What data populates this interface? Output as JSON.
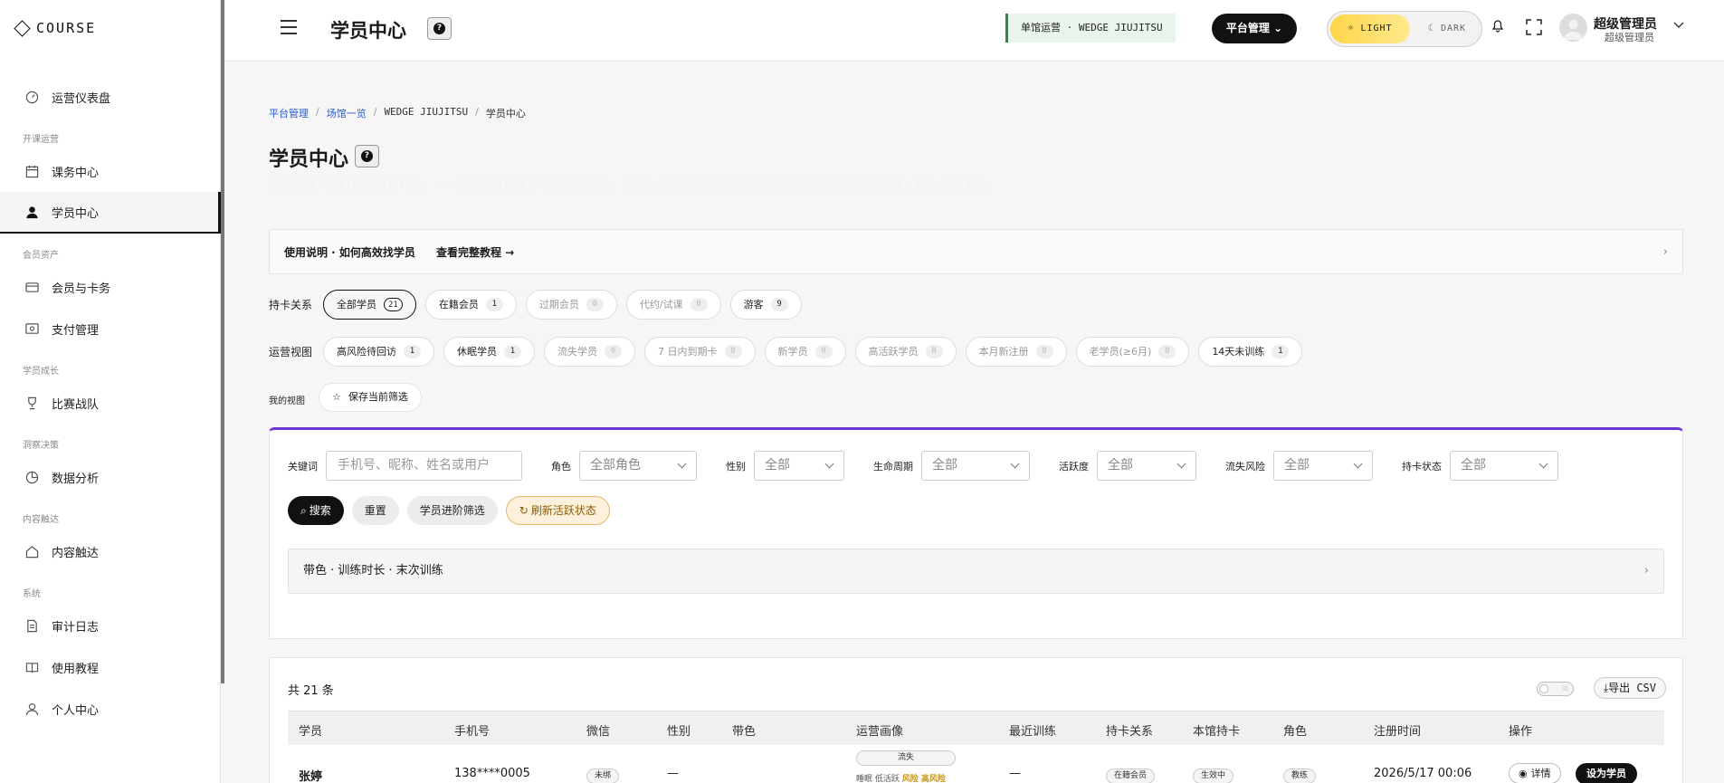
{
  "brand": {
    "name": "COURSE"
  },
  "sidebar": {
    "items": [
      {
        "label": "运营仪表盘",
        "icon": "gauge-icon"
      },
      {
        "group": "开课运营"
      },
      {
        "label": "课务中心",
        "icon": "calendar-icon"
      },
      {
        "label": "学员中心",
        "icon": "user-icon",
        "active": true
      },
      {
        "group": "会员资产"
      },
      {
        "label": "会员与卡务",
        "icon": "card-icon"
      },
      {
        "label": "支付管理",
        "icon": "payment-icon"
      },
      {
        "group": "学员成长"
      },
      {
        "label": "比赛战队",
        "icon": "trophy-icon"
      },
      {
        "group": "洞察决策"
      },
      {
        "label": "数据分析",
        "icon": "chart-icon"
      },
      {
        "group": "内容触达"
      },
      {
        "label": "内容触达",
        "icon": "home-icon"
      },
      {
        "group": "系统"
      },
      {
        "label": "审计日志",
        "icon": "document-icon"
      },
      {
        "label": "使用教程",
        "icon": "book-icon"
      },
      {
        "label": "个人中心",
        "icon": "person-icon"
      }
    ]
  },
  "topbar": {
    "title": "学员中心",
    "venue": "单馆运营 · WEDGE JIUJITSU",
    "platform_btn": "平台管理",
    "theme_light": "LIGHT",
    "theme_dark": "DARK",
    "user_name": "超级管理员",
    "user_role": "超级管理员"
  },
  "breadcrumb": {
    "items": [
      "平台管理",
      "场馆一览",
      "WEDGE JIUJITSU",
      "学员中心"
    ]
  },
  "page": {
    "title": "学员中心",
    "description": "当前场馆「WEDGE JIUJITSU」——列表与详情操作均限定在该馆。列表中的彩色标签为系统根据签到自动计算的运营画像，纳入工作关注。"
  },
  "guide": {
    "title": "使用说明 · 如何高效找学员",
    "link": "查看完整教程 →"
  },
  "card_relation": {
    "label": "持卡关系",
    "chips": [
      {
        "label": "全部学员",
        "count": "21",
        "selected": true
      },
      {
        "label": "在籍会员",
        "count": "1"
      },
      {
        "label": "过期会员",
        "count": "0",
        "muted": true
      },
      {
        "label": "代约/试课",
        "count": "0",
        "muted": true
      },
      {
        "label": "游客",
        "count": "9"
      }
    ]
  },
  "ops_view": {
    "label": "运营视图",
    "chips": [
      {
        "label": "高风险待回访",
        "count": "1"
      },
      {
        "label": "休眠学员",
        "count": "1"
      },
      {
        "label": "流失学员",
        "count": "0",
        "muted": true
      },
      {
        "label": "7 日内到期卡",
        "count": "0",
        "muted": true
      },
      {
        "label": "新学员",
        "count": "0",
        "muted": true
      },
      {
        "label": "高活跃学员",
        "count": "0",
        "muted": true
      },
      {
        "label": "本月新注册",
        "count": "0",
        "muted": true
      },
      {
        "label": "老学员(≥6月)",
        "count": "0",
        "muted": true
      },
      {
        "label": "14天未训练",
        "count": "1"
      }
    ]
  },
  "my_view": {
    "label": "我的视图",
    "save": "保存当前筛选"
  },
  "filters": {
    "keyword_label": "关键词",
    "keyword_placeholder": "手机号、昵称、姓名或用户",
    "selects": [
      {
        "label": "角色",
        "value": "全部角色"
      },
      {
        "label": "性别",
        "value": "全部"
      },
      {
        "label": "生命周期",
        "value": "全部"
      },
      {
        "label": "活跃度",
        "value": "全部"
      },
      {
        "label": "流失风险",
        "value": "全部"
      },
      {
        "label": "持卡状态",
        "value": "全部"
      }
    ],
    "buttons": {
      "search": "搜索",
      "reset": "重置",
      "advanced": "学员进阶筛选",
      "refresh": "刷新活跃状态"
    },
    "collapse": "带色 · 训练时长 · 末次训练"
  },
  "table": {
    "total": "共 21 条",
    "toggle_label": "简",
    "export": "导出 CSV",
    "headers": [
      "学员",
      "手机号",
      "微信",
      "性别",
      "带色",
      "运营画像",
      "最近训练",
      "持卡关系",
      "本馆持卡",
      "角色",
      "注册时间",
      "操作"
    ],
    "rows": [
      {
        "name": "张婷",
        "phone": "138****0005",
        "wechat": "未绑",
        "gender": "—",
        "belt": "",
        "profile_tag": "流失",
        "profile_sub": "睡眠 低活跃 ",
        "profile_risk": "风险 高风险",
        "last_training": "—",
        "relation": "在籍会员",
        "card": "生效中",
        "role": "教练",
        "registered": "2026/5/17 00:06",
        "detail": "详情",
        "set": "设为学员"
      }
    ]
  }
}
